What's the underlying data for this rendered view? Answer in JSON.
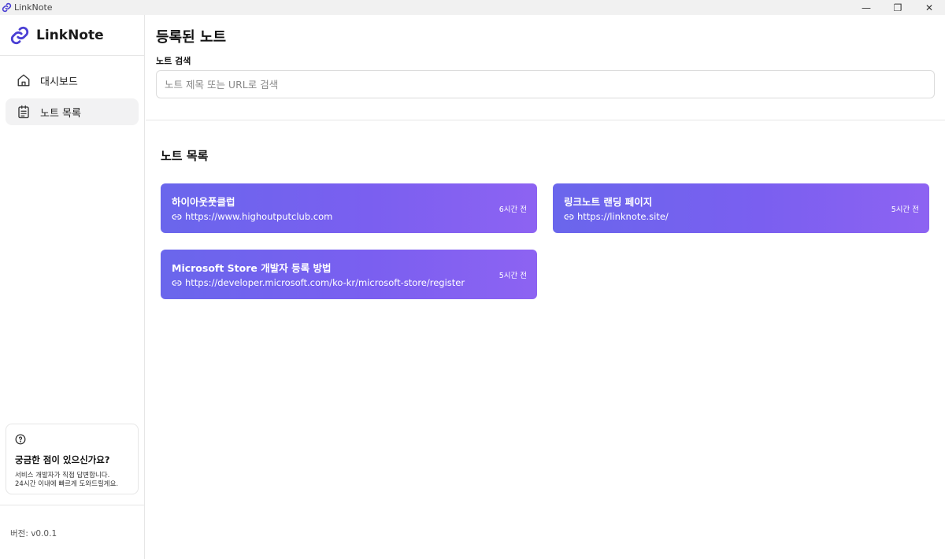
{
  "window": {
    "title": "LinkNote",
    "minimize": "—",
    "restore": "❐",
    "close": "✕"
  },
  "sidebar": {
    "brand": "LinkNote",
    "nav": [
      {
        "label": "대시보드",
        "icon": "home-icon",
        "active": false
      },
      {
        "label": "노트 목록",
        "icon": "clipboard-list-icon",
        "active": true
      }
    ],
    "help": {
      "title": "궁금한 점이 있으신가요?",
      "line1": "서비스 개발자가 직접 답변합니다.",
      "line2": "24시간 이내에 빠르게 도와드릴게요."
    },
    "version": "버전: v0.0.1"
  },
  "main": {
    "title": "등록된 노트",
    "search": {
      "label": "노트 검색",
      "placeholder": "노트 제목 또는 URL로 검색",
      "value": ""
    },
    "section_title": "노트 목록",
    "notes": [
      {
        "title": "하이아웃풋클럽",
        "url": "https://www.highoutputclub.com",
        "time": "6시간 전"
      },
      {
        "title": "링크노트 랜딩 페이지",
        "url": "https://linknote.site/",
        "time": "5시간 전"
      },
      {
        "title": "Microsoft Store 개발자 등록 방법",
        "url": "https://developer.microsoft.com/ko-kr/microsoft-store/register",
        "time": "5시간 전"
      }
    ]
  },
  "colors": {
    "accent": "#5b4ce0",
    "card_start": "#6a66ec",
    "card_end": "#8d63f2"
  }
}
